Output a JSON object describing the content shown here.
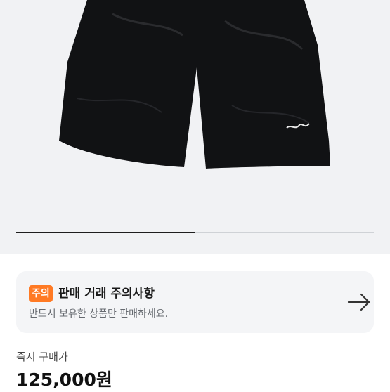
{
  "product": {
    "image_icon": "black-shorts-image",
    "gallery_progress": 0.5
  },
  "notice": {
    "badge": "주의",
    "title": "판매 거래 주의사항",
    "description": "반드시 보유한 상품만 판매하세요.",
    "arrow_icon": "arrow-right-icon"
  },
  "pricing": {
    "label": "즉시 구매가",
    "value": "125,000원"
  },
  "colors": {
    "badge": "#ff7a24",
    "hero_bg": "#f1f2f4",
    "card_bg": "#f4f5f7"
  }
}
